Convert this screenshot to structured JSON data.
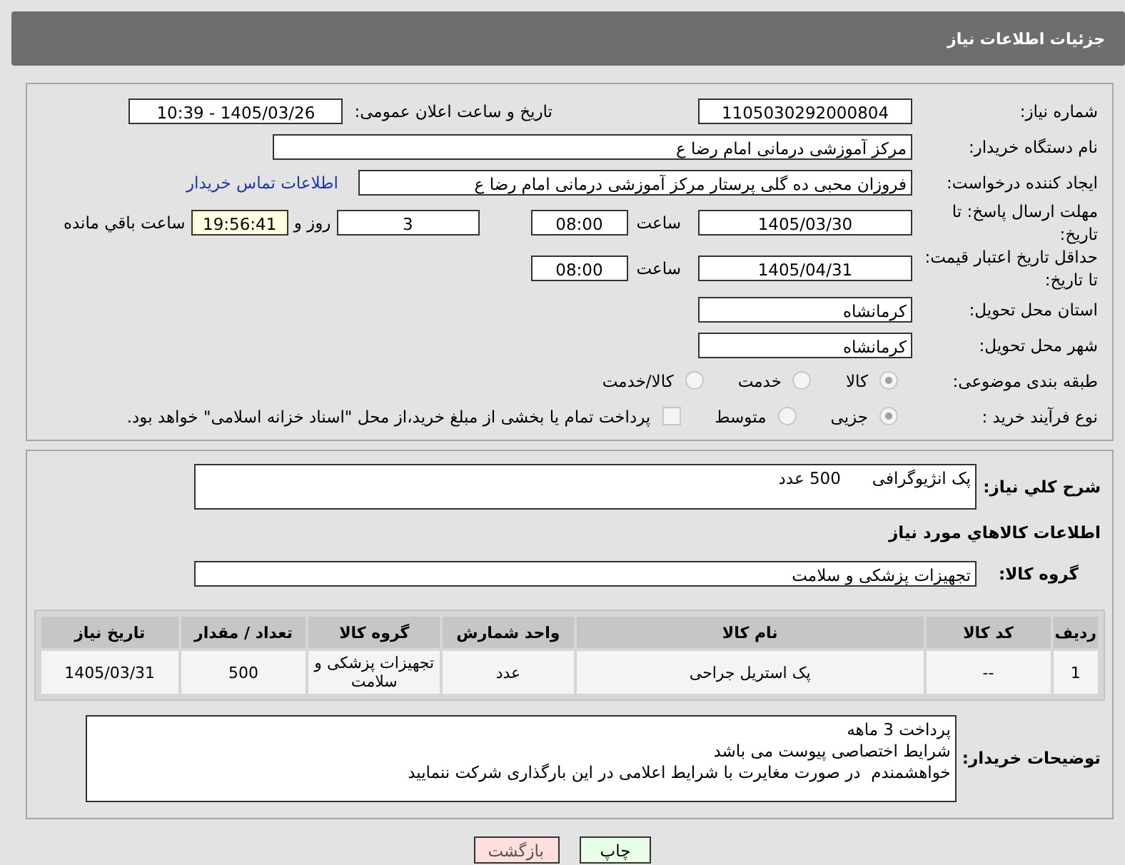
{
  "header": {
    "title": "جزئیات اطلاعات نیاز"
  },
  "form": {
    "need_number": {
      "label": "شماره نیاز:",
      "value": "1105030292000804"
    },
    "announce": {
      "label": "تاریخ و ساعت اعلان عمومی:",
      "value": "1405/03/26 - 10:39"
    },
    "buyer": {
      "label": "نام دستگاه خریدار:",
      "value": "مرکز آموزشی  درمانی امام رضا  ع"
    },
    "creator": {
      "label": "ایجاد کننده درخواست:",
      "value": "فروزان محبی ده گلی پرستار مرکز آموزشی  درمانی امام رضا  ع",
      "link": "اطلاعات تماس خریدار"
    },
    "deadline": {
      "label": "مهلت ارسال پاسخ: تا تاریخ:",
      "date": "1405/03/30",
      "time_label": "ساعت",
      "time": "08:00",
      "days": "3",
      "days_label": "روز و",
      "remaining": "19:56:41",
      "remaining_label": "ساعت باقي مانده"
    },
    "validity": {
      "label": "حداقل تاریخ اعتبار قیمت: تا تاریخ:",
      "date": "1405/04/31",
      "time_label": "ساعت",
      "time": "08:00"
    },
    "province": {
      "label": "استان محل تحویل:",
      "value": "کرمانشاه"
    },
    "city": {
      "label": "شهر محل تحویل:",
      "value": "کرمانشاه"
    },
    "category": {
      "label": "طبقه بندی موضوعی:",
      "options": [
        {
          "label": "کالا",
          "selected": true
        },
        {
          "label": "خدمت",
          "selected": false
        },
        {
          "label": "کالا/خدمت",
          "selected": false
        }
      ]
    },
    "process": {
      "label": "نوع فرآیند خرید :",
      "options": [
        {
          "label": "جزیی",
          "selected": true
        },
        {
          "label": "متوسط",
          "selected": false
        }
      ],
      "treasury": {
        "label": "پرداخت تمام یا بخشی از مبلغ خرید،از محل \"اسناد خزانه اسلامی\" خواهد بود.",
        "checked": false
      }
    }
  },
  "details": {
    "description": {
      "label": "شرح کلي نیاز:",
      "value": "پک انژیوگرافی      500 عدد"
    },
    "goods_heading": "اطلاعات کالاهاي مورد نیاز",
    "group": {
      "label": "گروه کالا:",
      "value": "تجهیزات پزشکی و سلامت"
    },
    "table": {
      "columns": [
        "ردیف",
        "کد کالا",
        "نام کالا",
        "واحد شمارش",
        "گروه کالا",
        "تعداد / مقدار",
        "تاریخ نیاز"
      ],
      "rows": [
        [
          "1",
          "--",
          "پک استریل جراحی",
          "عدد",
          "تجهیزات پزشکی و سلامت",
          "500",
          "1405/03/31"
        ]
      ]
    },
    "buyer_notes": {
      "label": "توضیحات خریدار:",
      "lines": [
        "پرداخت 3 ماهه",
        "شرایط اختصاصی پیوست می باشد",
        "خواهشمندم  در صورت مغایرت با شرایط اعلامی در این بارگذاری شرکت ننمایید"
      ]
    }
  },
  "buttons": [
    {
      "label": "چاپ",
      "kind": "print"
    },
    {
      "label": "بازگشت",
      "kind": "back"
    }
  ]
}
